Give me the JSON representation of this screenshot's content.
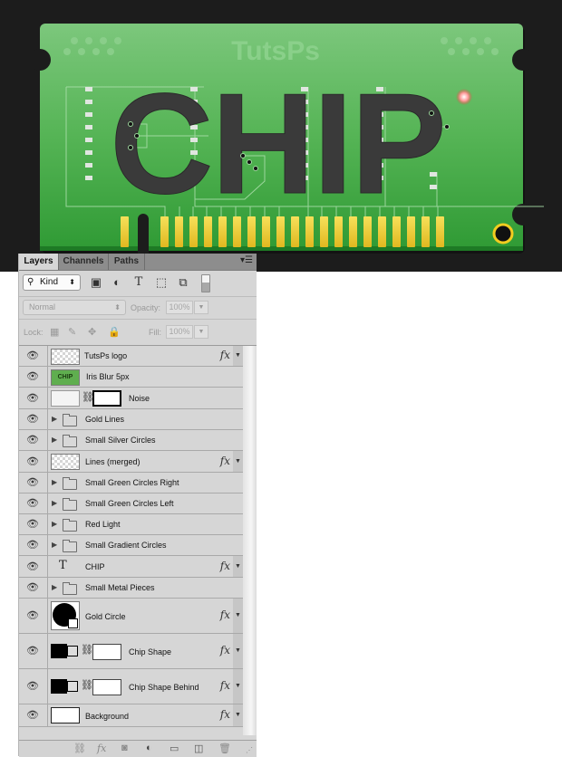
{
  "artwork": {
    "title_text": "TutsPs",
    "chip_text": "CHIP",
    "colors": {
      "background": "#1c1c1c",
      "board_green": "#4cb050",
      "board_green_light": "#79c47a",
      "letters": "#3a3a3a",
      "gold_pins": "#f0d23a",
      "red_light": "#ff8a8a",
      "gold_ring": "#f0c820"
    }
  },
  "panel": {
    "tabs": [
      {
        "label": "Layers",
        "active": true
      },
      {
        "label": "Channels",
        "active": false
      },
      {
        "label": "Paths",
        "active": false
      }
    ],
    "menu_icon": "panel-menu-icon",
    "filter": {
      "kind_label": "Kind",
      "icons": [
        "pixel-layer-filter-icon",
        "adjustment-layer-filter-icon",
        "type-layer-filter-icon",
        "shape-layer-filter-icon",
        "smart-object-filter-icon"
      ],
      "toggle": "filter-toggle"
    },
    "blend_mode": "Normal",
    "opacity_label": "Opacity:",
    "opacity_value": "100%",
    "lock_label": "Lock:",
    "fill_label": "Fill:",
    "fill_value": "100%",
    "layers": [
      {
        "name": "TutsPs logo",
        "type": "pixel",
        "fx": true
      },
      {
        "name": "Iris Blur 5px",
        "type": "pixel-chip",
        "fx": false
      },
      {
        "name": "Noise",
        "type": "masked",
        "fx": false
      },
      {
        "name": "Gold Lines",
        "type": "group",
        "fx": false
      },
      {
        "name": "Small Silver Circles",
        "type": "group",
        "fx": false
      },
      {
        "name": "Lines (merged)",
        "type": "pixel",
        "fx": true
      },
      {
        "name": "Small Green Circles Right",
        "type": "group",
        "fx": false
      },
      {
        "name": "Small Green Circles Left",
        "type": "group",
        "fx": false
      },
      {
        "name": "Red Light",
        "type": "group",
        "fx": false
      },
      {
        "name": "Small Gradient Circles",
        "type": "group",
        "fx": false
      },
      {
        "name": "CHIP",
        "type": "text",
        "fx": true
      },
      {
        "name": "Small Metal Pieces",
        "type": "group",
        "fx": false
      },
      {
        "name": "Gold Circle",
        "type": "shape-circle",
        "fx": true
      },
      {
        "name": "Chip Shape",
        "type": "shape-masked",
        "fx": true
      },
      {
        "name": "Chip Shape Behind",
        "type": "shape-masked",
        "fx": true
      },
      {
        "name": "Background",
        "type": "background",
        "fx": true
      }
    ],
    "fx_label": "fx",
    "bottom_icons": [
      "link-layers-icon",
      "add-style-icon",
      "add-mask-icon",
      "new-adjustment-icon",
      "new-group-icon",
      "new-layer-icon",
      "delete-layer-icon"
    ]
  }
}
